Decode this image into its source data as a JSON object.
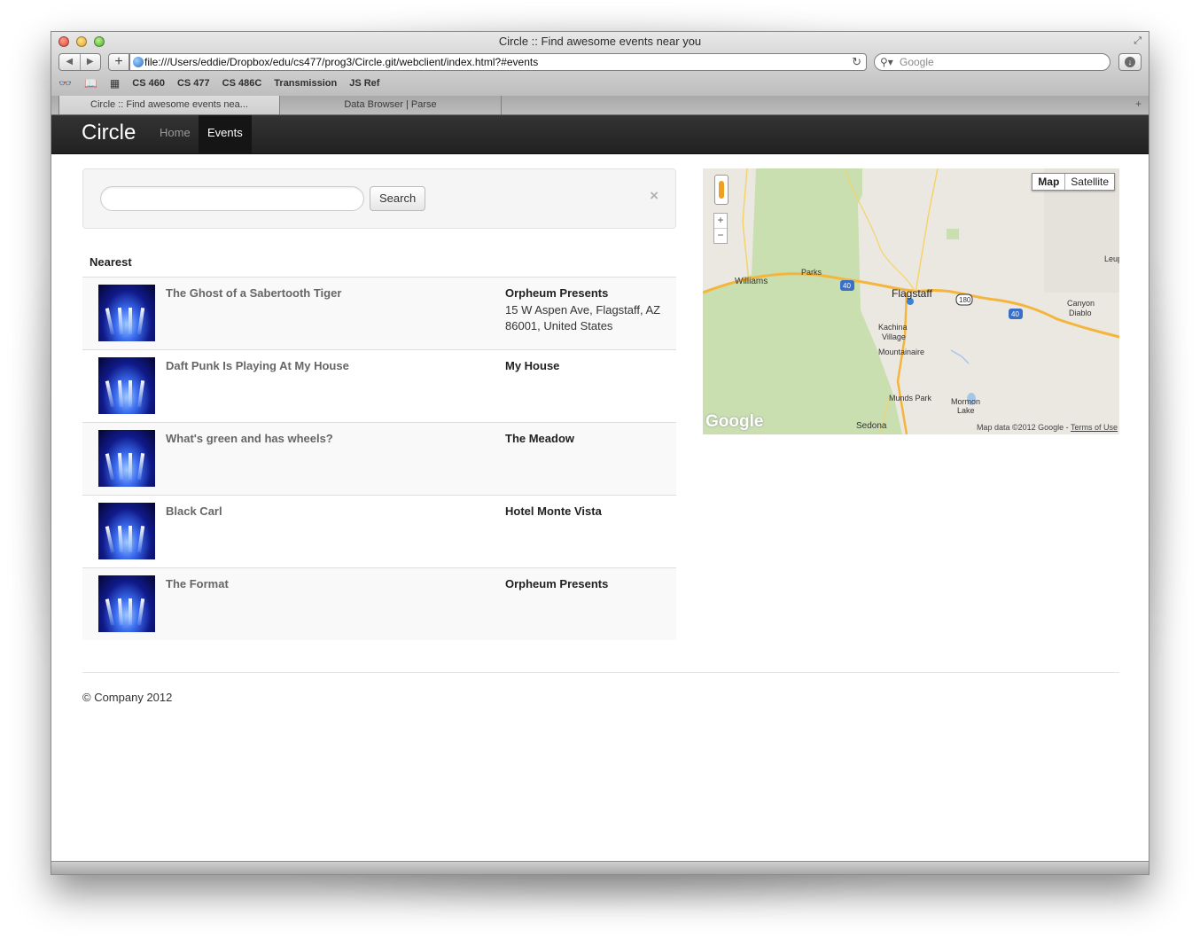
{
  "window": {
    "title": "Circle :: Find awesome events near you"
  },
  "toolbar": {
    "url": "file:///Users/eddie/Dropbox/edu/cs477/prog3/Circle.git/webclient/index.html?#events",
    "search_placeholder": "Google"
  },
  "bookmarks": [
    "CS 460",
    "CS 477",
    "CS 486C",
    "Transmission",
    "JS Ref"
  ],
  "tabs": [
    {
      "label": "Circle :: Find awesome events nea..."
    },
    {
      "label": "Data Browser | Parse"
    }
  ],
  "site": {
    "brand": "Circle",
    "nav": [
      {
        "label": "Home"
      },
      {
        "label": "Events"
      }
    ]
  },
  "search": {
    "value": "",
    "button_label": "Search",
    "close_glyph": "×"
  },
  "events": {
    "heading": "Nearest",
    "items": [
      {
        "title": "The Ghost of a Sabertooth Tiger",
        "venue": "Orpheum Presents",
        "address": "15 W Aspen Ave, Flagstaff, AZ 86001, United States"
      },
      {
        "title": "Daft Punk Is Playing At My House",
        "venue": "My House",
        "address": ""
      },
      {
        "title": "What's green and has wheels?",
        "venue": "The Meadow",
        "address": ""
      },
      {
        "title": "Black Carl",
        "venue": "Hotel Monte Vista",
        "address": ""
      },
      {
        "title": "The Format",
        "venue": "Orpheum Presents",
        "address": ""
      }
    ]
  },
  "map": {
    "type_buttons": [
      "Map",
      "Satellite"
    ],
    "zoom_in": "+",
    "zoom_out": "−",
    "logo": "Google",
    "attribution": "Map data ©2012 Google -",
    "terms": "Terms of Use",
    "labels": {
      "williams": "Williams",
      "parks": "Parks",
      "flagstaff": "Flagstaff",
      "kachina": "Kachina",
      "village": "Village",
      "mountainaire": "Mountainaire",
      "munds_park": "Munds Park",
      "mormon": "Mormon",
      "lake": "Lake",
      "sedona": "Sedona",
      "canyon": "Canyon",
      "diablo": "Diablo",
      "leup": "Leup",
      "i40_a": "40",
      "i40_b": "40",
      "us180": "180"
    },
    "colors": {
      "forest": "#c9dfb0",
      "land": "#ebe8e1",
      "highway": "#f5b53d"
    }
  },
  "footer": {
    "text": "© Company 2012"
  },
  "colors": {
    "navbar_bg": "#222222",
    "accent_link": "#666666"
  }
}
